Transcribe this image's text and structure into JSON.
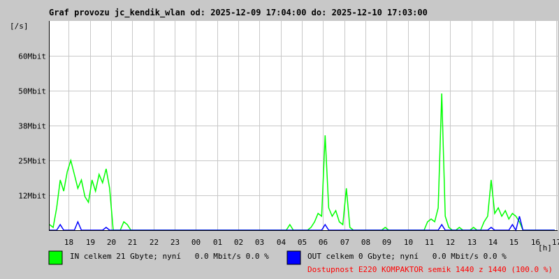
{
  "chart_data": {
    "type": "line",
    "title": "Graf provozu jc_kendik_wlan od: 2025-12-09 17:04:00 do: 2025-12-10 17:03:00",
    "ylabel": "[/s]",
    "xlabel": "[h]",
    "ylim": [
      0,
      75
    ],
    "y_ticks": [
      {
        "value": 12.5,
        "label": "12Mbit"
      },
      {
        "value": 25,
        "label": "25Mbit"
      },
      {
        "value": 37.5,
        "label": "38Mbit"
      },
      {
        "value": 50,
        "label": "50Mbit"
      },
      {
        "value": 62.5,
        "label": "60Mbit"
      }
    ],
    "x_ticks": [
      "18",
      "19",
      "20",
      "21",
      "22",
      "23",
      "00",
      "01",
      "02",
      "03",
      "04",
      "05",
      "06",
      "07",
      "08",
      "09",
      "10",
      "11",
      "12",
      "13",
      "14",
      "15",
      "16",
      "17"
    ],
    "x_start_minute": 4,
    "sample_minutes": 10,
    "grid": true,
    "series": [
      {
        "name": "IN",
        "color": "#00ff00",
        "values": [
          2,
          1,
          8,
          18,
          14,
          21,
          25,
          20,
          15,
          18,
          12,
          10,
          18,
          14,
          20,
          17,
          22,
          15,
          0,
          0,
          0,
          3,
          2,
          0,
          0,
          0,
          0,
          0,
          0,
          0,
          0,
          0,
          0,
          0,
          0,
          0,
          0,
          0,
          0,
          0,
          0,
          0,
          0,
          0,
          0,
          0,
          0,
          0,
          0,
          0,
          0,
          0,
          0,
          0,
          0,
          0,
          0,
          0,
          0,
          0,
          0,
          0,
          0,
          0,
          0,
          0,
          0,
          0,
          2,
          0,
          0,
          0,
          0,
          0,
          1,
          3,
          6,
          5,
          34,
          8,
          5,
          7,
          3,
          2,
          15,
          1,
          0,
          0,
          0,
          0,
          0,
          0,
          0,
          0,
          0,
          1,
          0,
          0,
          0,
          0,
          0,
          0,
          0,
          0,
          0,
          0,
          0,
          3,
          4,
          3,
          8,
          49,
          5,
          1,
          0,
          0,
          1,
          0,
          0,
          0,
          1,
          0,
          0,
          3,
          5,
          18,
          6,
          8,
          5,
          7,
          4,
          6,
          5,
          3,
          0,
          0,
          0,
          0,
          0,
          0,
          0,
          0,
          0,
          0
        ]
      },
      {
        "name": "OUT",
        "color": "#0000ff",
        "values": [
          0,
          0,
          0,
          2,
          0,
          0,
          0,
          0,
          3,
          0,
          0,
          0,
          0,
          0,
          0,
          0,
          1,
          0,
          0,
          0,
          0,
          0,
          0,
          0,
          0,
          0,
          0,
          0,
          0,
          0,
          0,
          0,
          0,
          0,
          0,
          0,
          0,
          0,
          0,
          0,
          0,
          0,
          0,
          0,
          0,
          0,
          0,
          0,
          0,
          0,
          0,
          0,
          0,
          0,
          0,
          0,
          0,
          0,
          0,
          0,
          0,
          0,
          0,
          0,
          0,
          0,
          0,
          0,
          0,
          0,
          0,
          0,
          0,
          0,
          0,
          0,
          0,
          0,
          2,
          0,
          0,
          0,
          0,
          0,
          0,
          0,
          0,
          0,
          0,
          0,
          0,
          0,
          0,
          0,
          0,
          0,
          0,
          0,
          0,
          0,
          0,
          0,
          0,
          0,
          0,
          0,
          0,
          0,
          0,
          0,
          0,
          2,
          0,
          0,
          0,
          0,
          0,
          0,
          0,
          0,
          0,
          0,
          0,
          0,
          0,
          1,
          0,
          0,
          0,
          0,
          0,
          2,
          0,
          5,
          0,
          0,
          0,
          0,
          0,
          0,
          0,
          0,
          0,
          0
        ]
      }
    ]
  },
  "legend": {
    "in_text": "IN celkem 21 Gbyte; nyní   0.0 Mbit/s 0.0 %",
    "out_text": "OUT celkem 0 Gbyte; nyní   0.0 Mbit/s 0.0 %",
    "availability": "Dostupnost E220 KOMPAKTOR semik 1440 z 1440 (100.0 %)",
    "availability_color": "#ff0000"
  }
}
